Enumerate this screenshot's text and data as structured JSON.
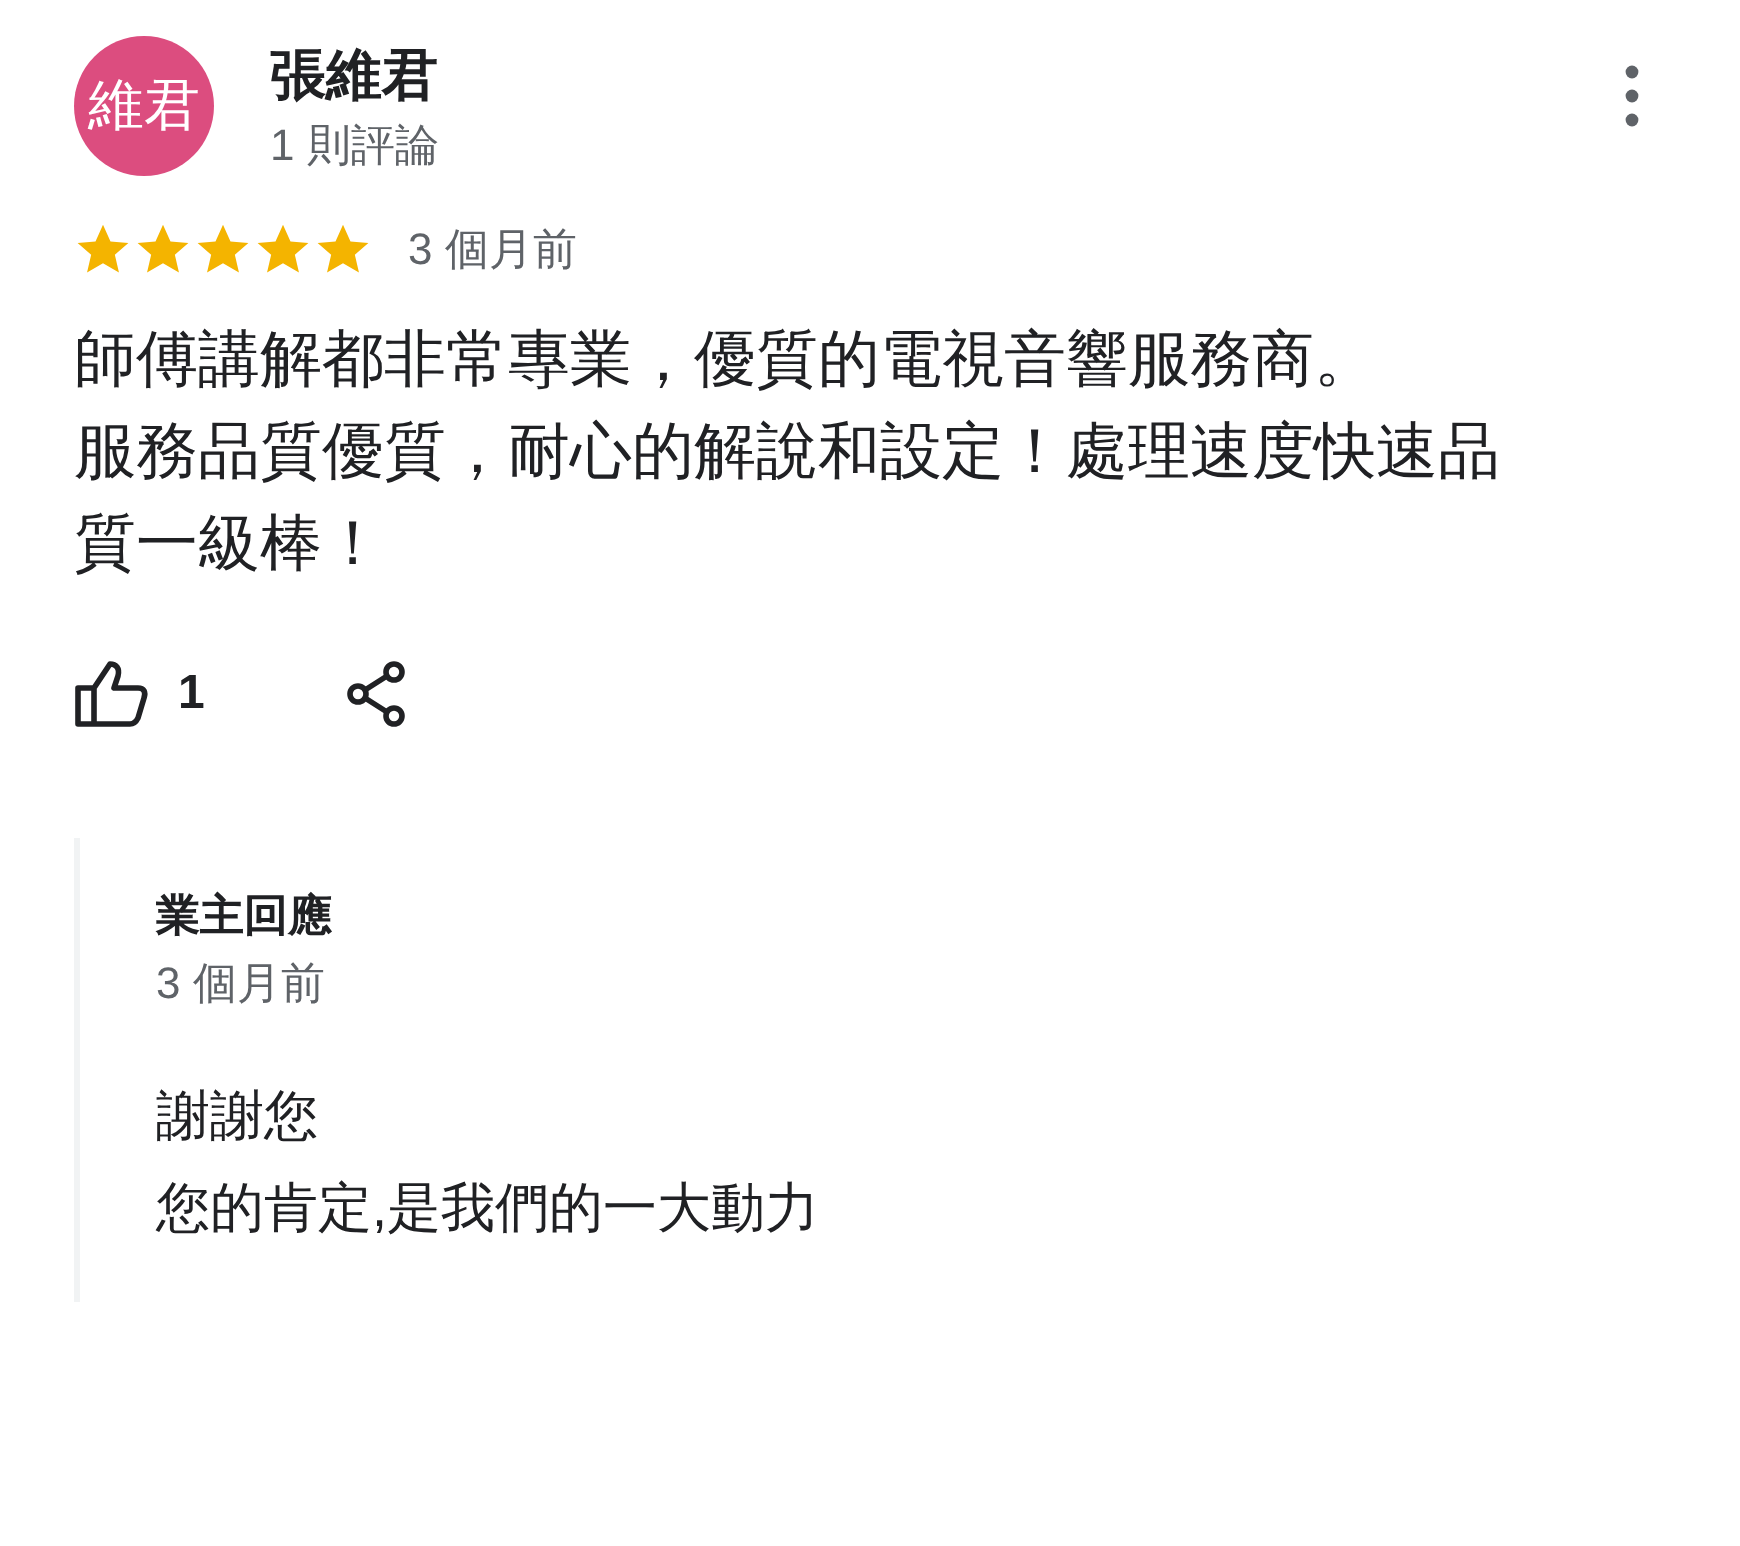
{
  "review": {
    "avatar_text": "維君",
    "name": "張維君",
    "review_count": "1 則評論",
    "stars": 5,
    "time": "3 個月前",
    "body": [
      "師傅講解都非常專業，優質的電視音響服務商。",
      "服務品質優質，耐心的解說和設定！處理速度快速品質一級棒！"
    ],
    "likes": "1"
  },
  "reply": {
    "label": "業主回應",
    "time": "3 個月前",
    "text": [
      "謝謝您",
      "您的肯定,是我們的一大動力"
    ]
  }
}
